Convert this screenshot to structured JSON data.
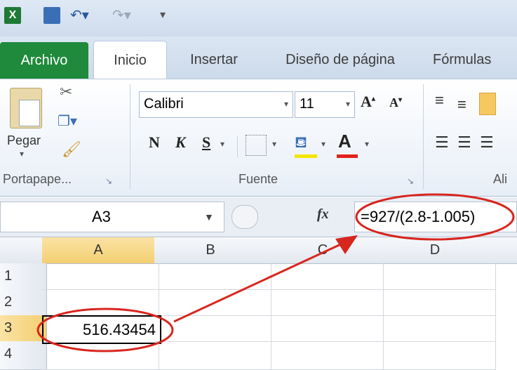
{
  "qat": {
    "excel_icon": "excel-icon",
    "save_icon": "save-icon",
    "undo_icon": "undo-icon",
    "redo_icon": "redo-icon"
  },
  "tabs": [
    "Archivo",
    "Inicio",
    "Insertar",
    "Diseño de página",
    "Fórmulas"
  ],
  "ribbon": {
    "paste_label": "Pegar",
    "font_name": "Calibri",
    "font_size": "11",
    "bold": "N",
    "italic": "K",
    "underline": "S",
    "group_clipboard": "Portapape...",
    "group_font": "Fuente",
    "group_align": "Ali"
  },
  "formula_bar": {
    "name_box": "A3",
    "fx": "fx",
    "formula": "=927/(2.8-1.005)"
  },
  "grid": {
    "columns": [
      "A",
      "B",
      "C",
      "D"
    ],
    "rows": [
      "1",
      "2",
      "3",
      "4"
    ],
    "cell_a3": "516.43454"
  },
  "colors": {
    "highlight": "#d7261e",
    "archivo_tab": "#1f8a3b",
    "selected_header": "#f7d889"
  }
}
